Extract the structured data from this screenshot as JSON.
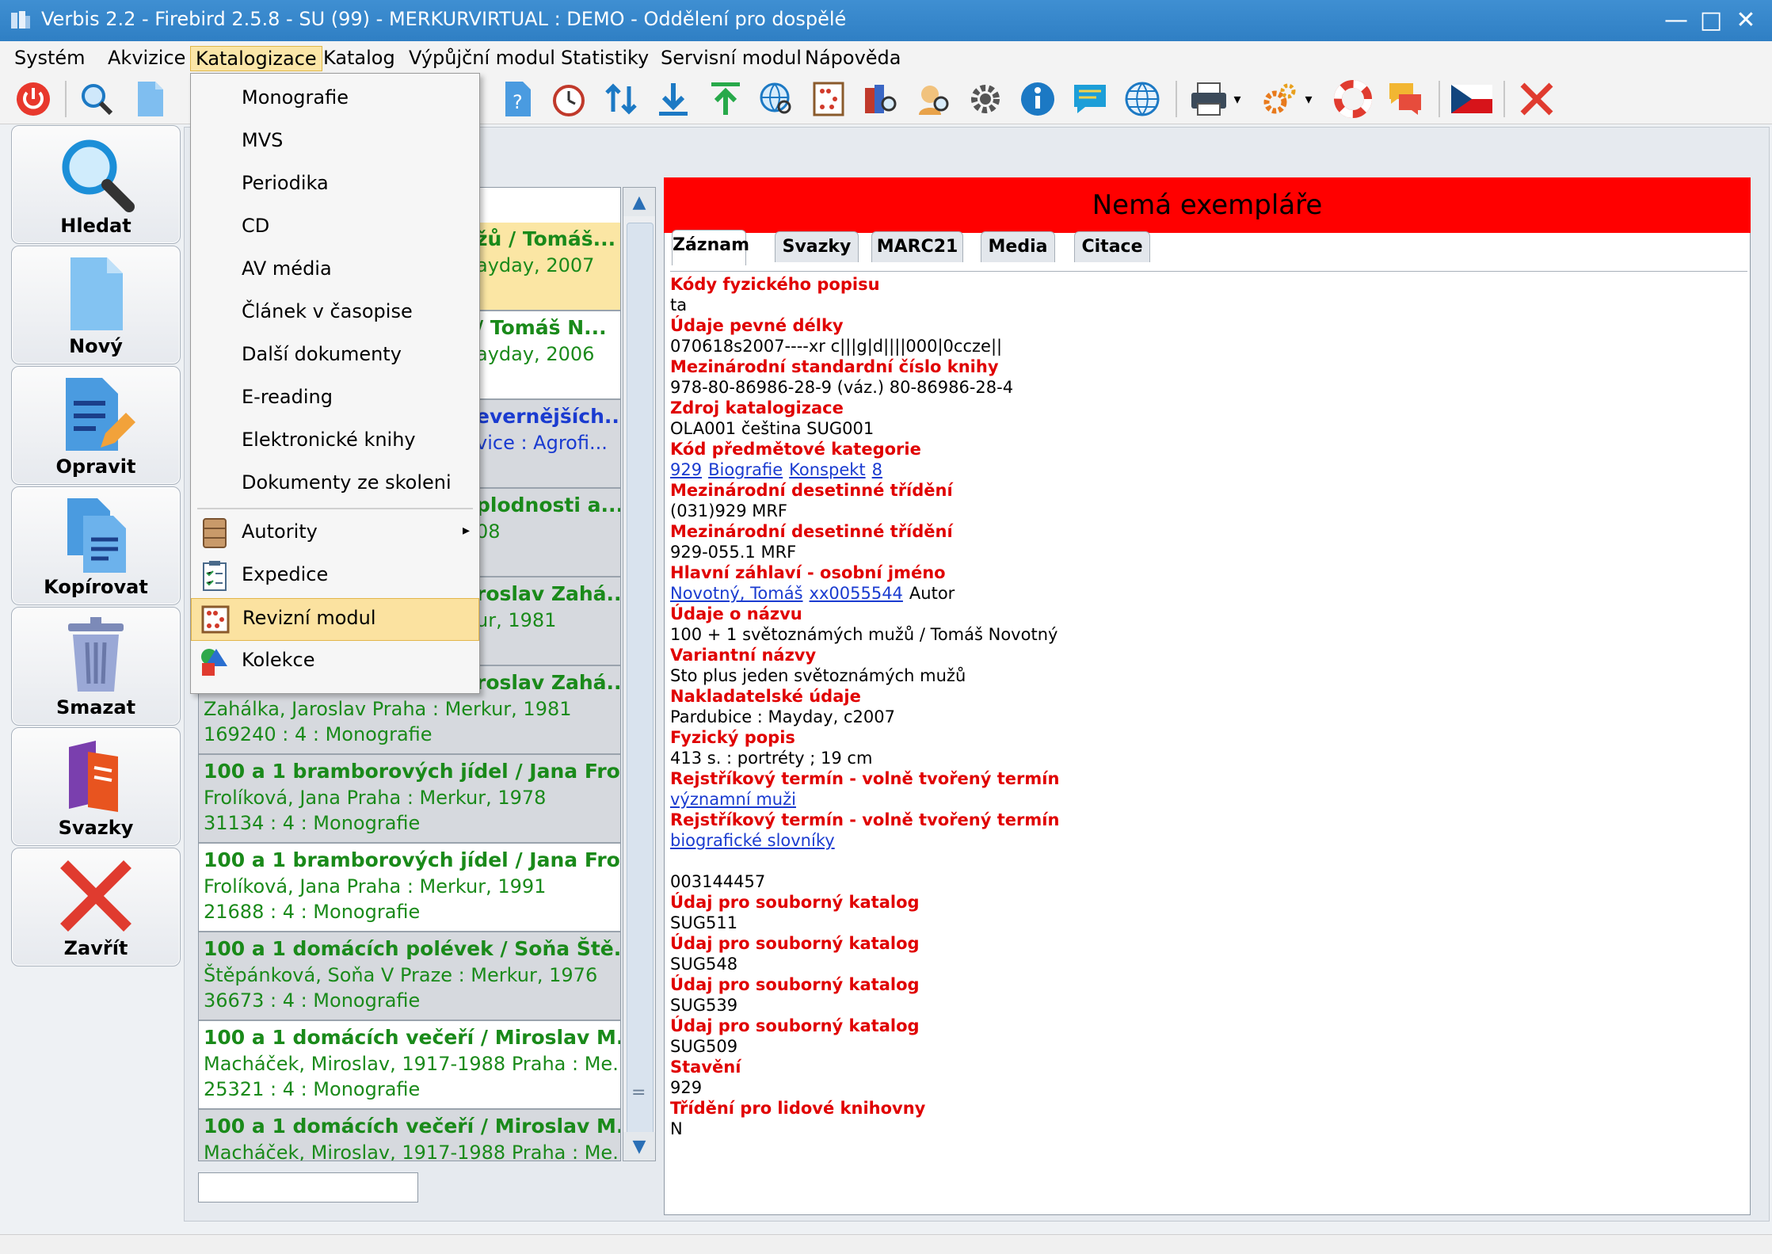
{
  "window": {
    "title": "Verbis 2.2 - Firebird 2.5.8 - SU (99) - MERKURVIRTUAL : DEMO - Oddělení pro dospělé",
    "minimize": "—",
    "maximize": "□",
    "close": "✕"
  },
  "menubar": {
    "items": [
      "Systém",
      "Akvizice",
      "Katalogizace",
      "Katalog",
      "Výpůjční modul",
      "Statistiky",
      "Servisní modul",
      "Nápověda"
    ]
  },
  "toolbar": {
    "icons": [
      "power-icon",
      "search-icon",
      "new-doc-icon",
      "help-doc-icon",
      "alarm-clock-icon",
      "sort-icon",
      "download-icon",
      "upload-icon",
      "web-search-icon",
      "abacus-icon",
      "books-search-icon",
      "user-search-icon",
      "settings-icon",
      "info-icon",
      "chat-icon",
      "globe-icon",
      "printer-icon",
      "gears-icon",
      "lifebuoy-icon",
      "messages-icon",
      "czech-flag-icon",
      "close-icon"
    ]
  },
  "sidebar": {
    "items": [
      {
        "label": "Hledat",
        "icon": "search-icon"
      },
      {
        "label": "Nový",
        "icon": "new-document-icon"
      },
      {
        "label": "Opravit",
        "icon": "edit-icon"
      },
      {
        "label": "Kopírovat",
        "icon": "copy-icon"
      },
      {
        "label": "Smazat",
        "icon": "trash-icon"
      },
      {
        "label": "Svazky",
        "icon": "books-icon"
      },
      {
        "label": "Zavřít",
        "icon": "close-icon"
      }
    ]
  },
  "dropdown": {
    "items": [
      {
        "label": "Monografie"
      },
      {
        "label": "MVS"
      },
      {
        "label": "Periodika"
      },
      {
        "label": "CD"
      },
      {
        "label": "AV média"
      },
      {
        "label": "Článek v časopise"
      },
      {
        "label": "Další dokumenty"
      },
      {
        "label": "E-reading"
      },
      {
        "label": "Elektronické knihy"
      },
      {
        "label": "Dokumenty ze skoleni"
      },
      {
        "label": "Autority",
        "icon": "cabinet-icon"
      },
      {
        "label": "Expedice",
        "icon": "checklist-icon"
      },
      {
        "label": "Revizní modul",
        "icon": "abacus-icon"
      },
      {
        "label": "Kolekce",
        "icon": "shapes-icon"
      }
    ],
    "submenu_arrow": "▸"
  },
  "list": {
    "rows": [
      {
        "r1": "žů / Tomáš...",
        "r2": "ayday, 2007",
        "r3": ""
      },
      {
        "r1": "/ Tomáš N...",
        "r2": "ayday, 2006",
        "r3": ""
      },
      {
        "r1": "evernějších...",
        "r2": "vice : Agrofi...",
        "r3": ""
      },
      {
        "r1": "plodnosti a...",
        "r2": "08",
        "r3": ""
      },
      {
        "r1": "roslav Zahá...",
        "r2": "ur, 1981",
        "r3": ""
      },
      {
        "r1": "roslav Zahá...",
        "r2": "Zahálka, Jaroslav Praha : Merkur, 1981",
        "r3": "169240 : 4 : Monografie"
      },
      {
        "r1": "100 a 1 bramborových jídel / Jana Fro...",
        "r2": "Frolíková, Jana Praha : Merkur, 1978",
        "r3": "31134 : 4 : Monografie"
      },
      {
        "r1": "100 a 1 bramborových jídel / Jana Fro...",
        "r2": "Frolíková, Jana Praha : Merkur, 1991",
        "r3": "21688 : 4 : Monografie"
      },
      {
        "r1": "100 a 1 domácích polévek / Soňa Ště...",
        "r2": "Štěpánková, Soňa V Praze : Merkur, 1976",
        "r3": "36673 : 4 : Monografie"
      },
      {
        "r1": "100 a 1 domácích večeří / Miroslav M...",
        "r2": "Macháček, Miroslav, 1917-1988 Praha : Me...",
        "r3": "25321 : 4 : Monografie"
      },
      {
        "r1": "100 a 1 domácích večeří / Miroslav M...",
        "r2": "Macháček, Miroslav, 1917-1988 Praha : Me...",
        "r3": ""
      }
    ],
    "scroll_up": "▲",
    "scroll_down": "▼",
    "scroll_grip": "="
  },
  "detail": {
    "banner": "Nemá exempláře",
    "tabs": [
      "Záznam",
      "Svazky",
      "MARC21",
      "Media",
      "Citace"
    ],
    "fields": [
      {
        "label": "Kódy fyzického popisu",
        "value": "ta"
      },
      {
        "label": "Údaje pevné délky",
        "value": "070618s2007----xr c|||g|d||||000|0ccze||"
      },
      {
        "label": "Mezinárodní standardní číslo knihy",
        "value": "978-80-86986-28-9 (váz.)  80-86986-28-4"
      },
      {
        "label": "Zdroj katalogizace",
        "value": "OLA001  čeština SUG001"
      },
      {
        "label": "Kód předmětové kategorie",
        "links": [
          "929",
          "Biografie",
          "Konspekt",
          "8"
        ]
      },
      {
        "label": "Mezinárodní desetinné třídění",
        "value": "(031)929  MRF"
      },
      {
        "label": "Mezinárodní desetinné třídění",
        "value": "929-055.1  MRF"
      },
      {
        "label": "Hlavní záhlaví - osobní jméno",
        "links": [
          "Novotný, Tomáš",
          "xx0055544"
        ],
        "suffix": "Autor"
      },
      {
        "label": "Údaje o názvu",
        "value": "100 + 1 světoznámých mužů /  Tomáš Novotný"
      },
      {
        "label": "Variantní názvy",
        "value": "Sto plus jeden světoznámých mužů"
      },
      {
        "label": "Nakladatelské údaje",
        "value": "Pardubice :  Mayday,  c2007"
      },
      {
        "label": "Fyzický popis",
        "value": "413 s. :  portréty ;  19 cm"
      },
      {
        "label": "Rejstříkový termín - volně tvořený termín",
        "links": [
          "významní muži"
        ]
      },
      {
        "label": "Rejstříkový termín - volně tvořený termín",
        "links": [
          "biografické slovníky"
        ]
      },
      {
        "label": "",
        "value": ""
      },
      {
        "label": "",
        "value": "003144457"
      },
      {
        "label": "Údaj pro souborný katalog",
        "value": "SUG511"
      },
      {
        "label": "Údaj pro souborný katalog",
        "value": "SUG548"
      },
      {
        "label": "Údaj pro souborný katalog",
        "value": "SUG539"
      },
      {
        "label": "Údaj pro souborný katalog",
        "value": "SUG509"
      },
      {
        "label": "Stavění",
        "value": "929"
      },
      {
        "label": "Třídění pro lidové knihovny",
        "value": "N"
      }
    ]
  },
  "colors": {
    "titlebar": "#2f7fc4",
    "banner": "#ff0000",
    "field_label": "#e00000",
    "list_text": "#1a8a1a",
    "link": "#1a3bd0",
    "menu_highlight": "#fbe2a0"
  }
}
